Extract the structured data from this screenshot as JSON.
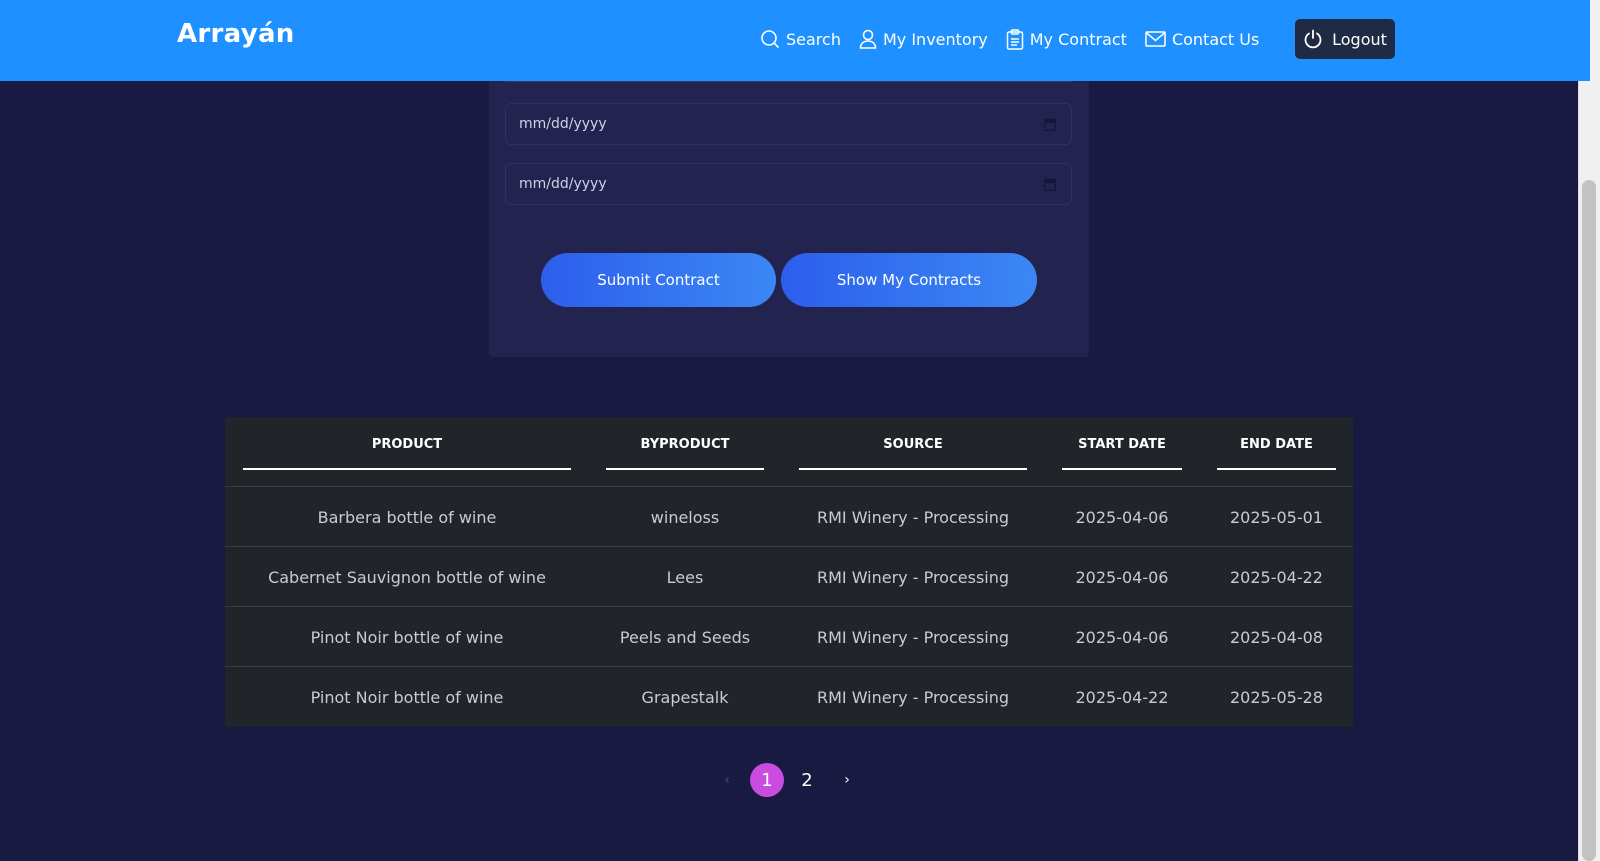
{
  "brand": "Arrayán",
  "nav": {
    "search": "Search",
    "inventory": "My Inventory",
    "contract": "My Contract",
    "contact": "Contact Us",
    "logout": "Logout"
  },
  "form": {
    "start_date_placeholder": "mm/dd/yyyy",
    "end_date_placeholder": "mm/dd/yyyy",
    "submit_label": "Submit Contract",
    "show_label": "Show My Contracts"
  },
  "table": {
    "headers": [
      "PRODUCT",
      "BYPRODUCT",
      "SOURCE",
      "START DATE",
      "END DATE"
    ],
    "rows": [
      [
        "Barbera bottle of wine",
        "wineloss",
        "RMI Winery - Processing",
        "2025-04-06",
        "2025-05-01"
      ],
      [
        "Cabernet Sauvignon bottle of wine",
        "Lees",
        "RMI Winery - Processing",
        "2025-04-06",
        "2025-04-22"
      ],
      [
        "Pinot Noir bottle of wine",
        "Peels and Seeds",
        "RMI Winery - Processing",
        "2025-04-06",
        "2025-04-08"
      ],
      [
        "Pinot Noir bottle of wine",
        "Grapestalk",
        "RMI Winery - Processing",
        "2025-04-22",
        "2025-05-28"
      ]
    ]
  },
  "pagination": {
    "prev": "‹",
    "pages": [
      "1",
      "2"
    ],
    "active": "1",
    "next": "›"
  },
  "colors": {
    "navbar": "#1e90ff",
    "background": "#181a42",
    "card": "#22234f",
    "table": "#212529",
    "active_page": "#c94be0"
  }
}
